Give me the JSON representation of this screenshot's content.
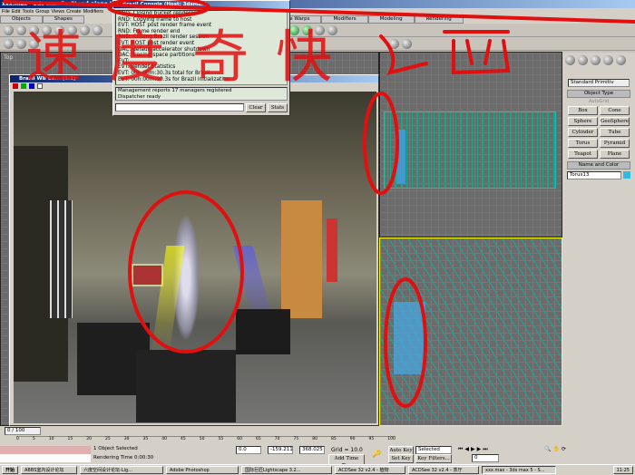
{
  "window": {
    "title": "xxx.max - 3ds max 5 - Stand-alone License"
  },
  "menu": [
    "File",
    "Edit",
    "Tools",
    "Group",
    "Views",
    "Create",
    "Modifiers"
  ],
  "tabs": [
    "Objects",
    "Shapes",
    "Space Warps",
    "Modifiers",
    "Modeling",
    "Rendering"
  ],
  "console": {
    "title": "Brazil Console (Host: 3dsMax)",
    "log": [
      "RND: Closing bucket renderer",
      "RND: Copying frame to host",
      "EVT: HOST post render frame event",
      "RND: Frame render end",
      "RND: Closing Brazil render session",
      "EVT: HOST post render event",
      "DAC: default accelerator shutdown",
      "DAC: freeing space partitions",
      "EVT:",
      "EVT: Render Statistics",
      "EVT: 00h:00m:30.3s total for Brazil",
      "EVT: 00h:00m:00.3s for Brazil initialization"
    ],
    "messages": [
      "Management reports 17 managers registered",
      "Dispatcher ready"
    ],
    "clear": "Clear",
    "stats": "Stats"
  },
  "render_window": {
    "title": "Brazil WB Ca... (1:1)"
  },
  "viewport_label": "Top",
  "command_panel": {
    "dropdown": "Standard Primitiv",
    "object_type": "Object Type",
    "autogrid": "AutoGrid",
    "buttons": [
      "Box",
      "Cone",
      "Sphere",
      "GeoSphere",
      "Cylinder",
      "Tube",
      "Torus",
      "Pyramid",
      "Teapot",
      "Plane"
    ],
    "name_and_color": "Name and Color",
    "name": "Torus13",
    "color": "#33bbdd"
  },
  "timeline": {
    "frame": "0 / 100",
    "ticks": [
      "0",
      "5",
      "10",
      "15",
      "20",
      "25",
      "30",
      "35",
      "40",
      "45",
      "50",
      "55",
      "60",
      "65",
      "70",
      "75",
      "80",
      "85",
      "90",
      "95",
      "100"
    ]
  },
  "status": {
    "selected": "1 Object Selected",
    "render_time": "Rendering Time  0:00:30",
    "x": "0.0",
    "y": "-159.211",
    "z": "368.025",
    "grid": "Grid = 10.0",
    "add_time_tag": "Add Time Tag",
    "auto_key": "Auto Key",
    "set_key": "Set Key",
    "selected_dd": "Selected",
    "key_filters": "Key Filters...",
    "frame_field": "0"
  },
  "taskbar": {
    "start": "开始",
    "items": [
      "ABBS室内设计论坛",
      "六度空间设计论坛-Lig...",
      "Adobe Photoshop",
      "国际巨匠Lightscape 3.2...",
      "ACDSee 32 v2.4 - 植物",
      "ACDSee 32 v2.4 - 茶厅",
      "xxx.max - 3ds max 5 - S..."
    ],
    "clock": "11:25"
  },
  "annotation": {
    "text": "速度奇快",
    "accent": "#e01010"
  }
}
